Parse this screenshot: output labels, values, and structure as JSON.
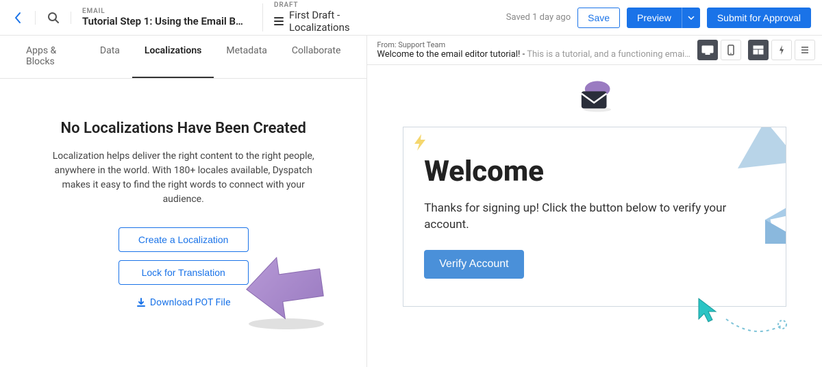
{
  "header": {
    "email_label": "EMAIL",
    "title": "Tutorial Step 1: Using the Email B…",
    "draft_label": "DRAFT",
    "draft_name": "First Draft - Localizations",
    "saved_text": "Saved 1 day ago",
    "save_btn": "Save",
    "preview_btn": "Preview",
    "submit_btn": "Submit for Approval"
  },
  "tabs": {
    "apps": "Apps & Blocks",
    "data": "Data",
    "localizations": "Localizations",
    "metadata": "Metadata",
    "collaborate": "Collaborate"
  },
  "loc": {
    "heading": "No Localizations Have Been Created",
    "desc": "Localization helps deliver the right content to the right people, anywhere in the world. With 180+ locales available, Dyspatch makes it easy to find the right words to connect with your audience.",
    "create_btn": "Create a Localization",
    "lock_btn": "Lock for Translation",
    "download": "Download POT File"
  },
  "preview": {
    "from_label": "From: ",
    "from_value": "Support Team",
    "subject_bold": "Welcome to the email editor tutorial! - ",
    "subject_gray": "This is a tutorial, and a functioning emai…",
    "welcome_heading": "Welcome",
    "welcome_body": "Thanks for signing up! Click the button below to verify your account.",
    "verify_btn": "Verify Account"
  }
}
